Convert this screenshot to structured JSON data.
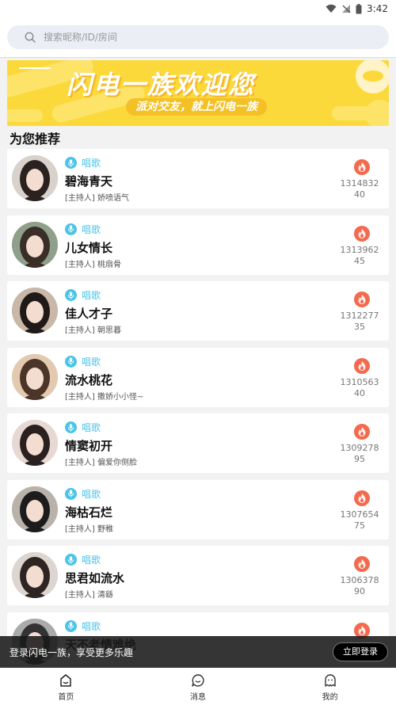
{
  "status_bar": {
    "time": "3:42"
  },
  "search": {
    "placeholder": "搜索昵称/ID/房间"
  },
  "banner": {
    "title": "闪电一族欢迎您",
    "subtitle": "派对交友，就上闪电一族"
  },
  "section_title": "为您推荐",
  "rooms": [
    {
      "tag": "唱歌",
      "name": "碧海青天",
      "host": "[主持人] 娇喷语气",
      "hot": "131483240"
    },
    {
      "tag": "唱歌",
      "name": "儿女情长",
      "host": "[主持人] 桃扇骨",
      "hot": "131396245"
    },
    {
      "tag": "唱歌",
      "name": "佳人才子",
      "host": "[主持人] 朝思暮",
      "hot": "131227735"
    },
    {
      "tag": "唱歌",
      "name": "流水桃花",
      "host": "[主持人] 撒娇小小怪~",
      "hot": "131056340"
    },
    {
      "tag": "唱歌",
      "name": "情窦初开",
      "host": "[主持人] 偏爱你侧脸",
      "hot": "130927895"
    },
    {
      "tag": "唱歌",
      "name": "海枯石烂",
      "host": "[主持人] 野稚",
      "hot": "130765475"
    },
    {
      "tag": "唱歌",
      "name": "思君如流水",
      "host": "[主持人] 清繇",
      "hot": "130637890"
    },
    {
      "tag": "唱歌",
      "name": "天不老情难绝",
      "host": "",
      "hot": ""
    }
  ],
  "login_bar": {
    "text": "登录闪电一族，享受更多乐趣",
    "button": "立即登录"
  },
  "nav": [
    {
      "label": "首页",
      "icon": "home-icon"
    },
    {
      "label": "消息",
      "icon": "message-icon"
    },
    {
      "label": "我的",
      "icon": "profile-icon"
    }
  ],
  "colors": {
    "accent": "#4bc4ea",
    "banner": "#fcd93b",
    "fire": "#f46a4e"
  }
}
